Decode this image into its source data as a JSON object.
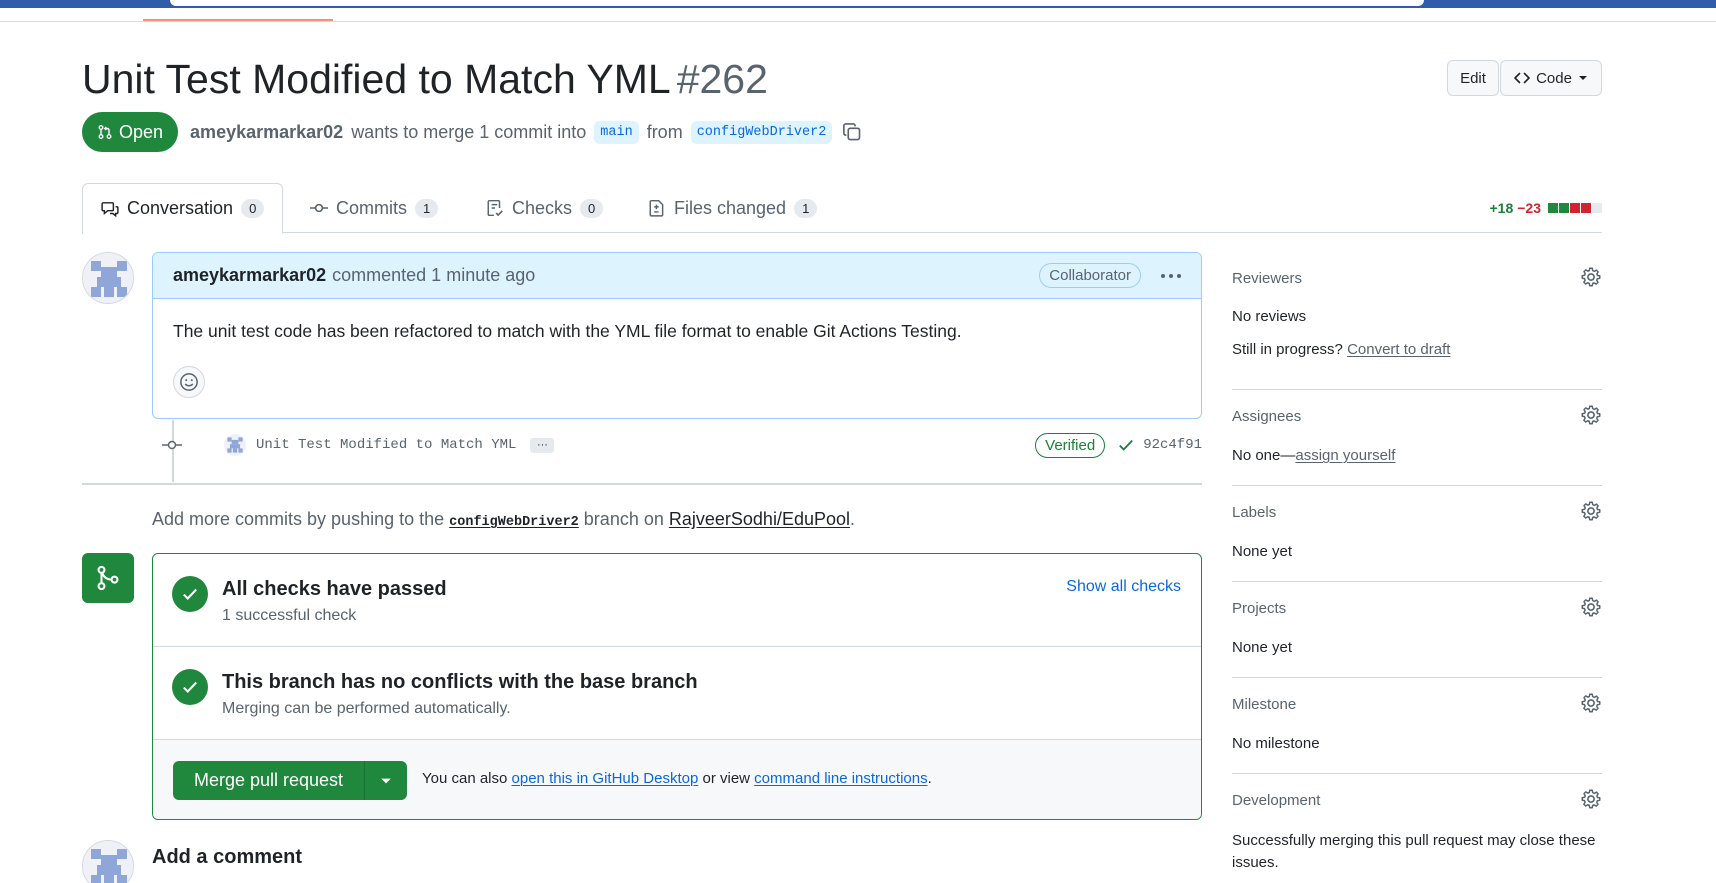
{
  "header": {
    "title": "Unit Test Modified to Match YML",
    "number": "#262",
    "edit_label": "Edit",
    "code_label": "Code"
  },
  "meta": {
    "state": "Open",
    "author": "ameykarmarkar02",
    "wants_to_merge": "wants to merge 1 commit into",
    "base_branch": "main",
    "from": "from",
    "head_branch": "configWebDriver2"
  },
  "tabs": [
    {
      "label": "Conversation",
      "count": "0"
    },
    {
      "label": "Commits",
      "count": "1"
    },
    {
      "label": "Checks",
      "count": "0"
    },
    {
      "label": "Files changed",
      "count": "1"
    }
  ],
  "diffstat": {
    "additions": "+18",
    "deletions": "−23"
  },
  "comment": {
    "author": "ameykarmarkar02",
    "time": "commented 1 minute ago",
    "role": "Collaborator",
    "body": "The unit test code has been refactored to match with the YML file format to enable Git Actions Testing."
  },
  "commit": {
    "message": "Unit Test Modified to Match YML",
    "more": "···",
    "verified": "Verified",
    "sha": "92c4f91"
  },
  "push_hint": {
    "prefix": "Add more commits by pushing to the",
    "branch": "configWebDriver2",
    "middle": "branch on",
    "repo": "RajveerSodhi/EduPool",
    "suffix": "."
  },
  "merge": {
    "checks_title": "All checks have passed",
    "checks_sub": "1 successful check",
    "show_all": "Show all checks",
    "conflicts_title": "This branch has no conflicts with the base branch",
    "conflicts_sub": "Merging can be performed automatically.",
    "merge_label": "Merge pull request",
    "also_prefix": "You can also",
    "desktop_link": "open this in GitHub Desktop",
    "or_view": "or view",
    "cli_link": "command line instructions",
    "period": "."
  },
  "add_comment": "Add a comment",
  "sidebar": {
    "reviewers": {
      "title": "Reviewers",
      "line1": "No reviews",
      "progress": "Still in progress?",
      "draft_link": "Convert to draft"
    },
    "assignees": {
      "title": "Assignees",
      "prefix": "No one—",
      "link": "assign yourself"
    },
    "labels": {
      "title": "Labels",
      "value": "None yet"
    },
    "projects": {
      "title": "Projects",
      "value": "None yet"
    },
    "milestone": {
      "title": "Milestone",
      "value": "No milestone"
    },
    "development": {
      "title": "Development",
      "value": "Successfully merging this pull request may close these issues."
    }
  },
  "colors": {
    "open_green": "#1f883d",
    "link_blue": "#0969da",
    "add_green": "#1a7f37",
    "del_red": "#d1242f",
    "comment_header_bg": "#ddf4ff"
  },
  "icons": [
    "pull-request-icon",
    "code-icon",
    "copy-icon",
    "conversation-icon",
    "commit-icon",
    "checklist-icon",
    "file-diff-icon",
    "smiley-icon",
    "check-icon",
    "git-merge-icon",
    "gear-icon",
    "kebab-icon",
    "triangle-down-icon"
  ]
}
